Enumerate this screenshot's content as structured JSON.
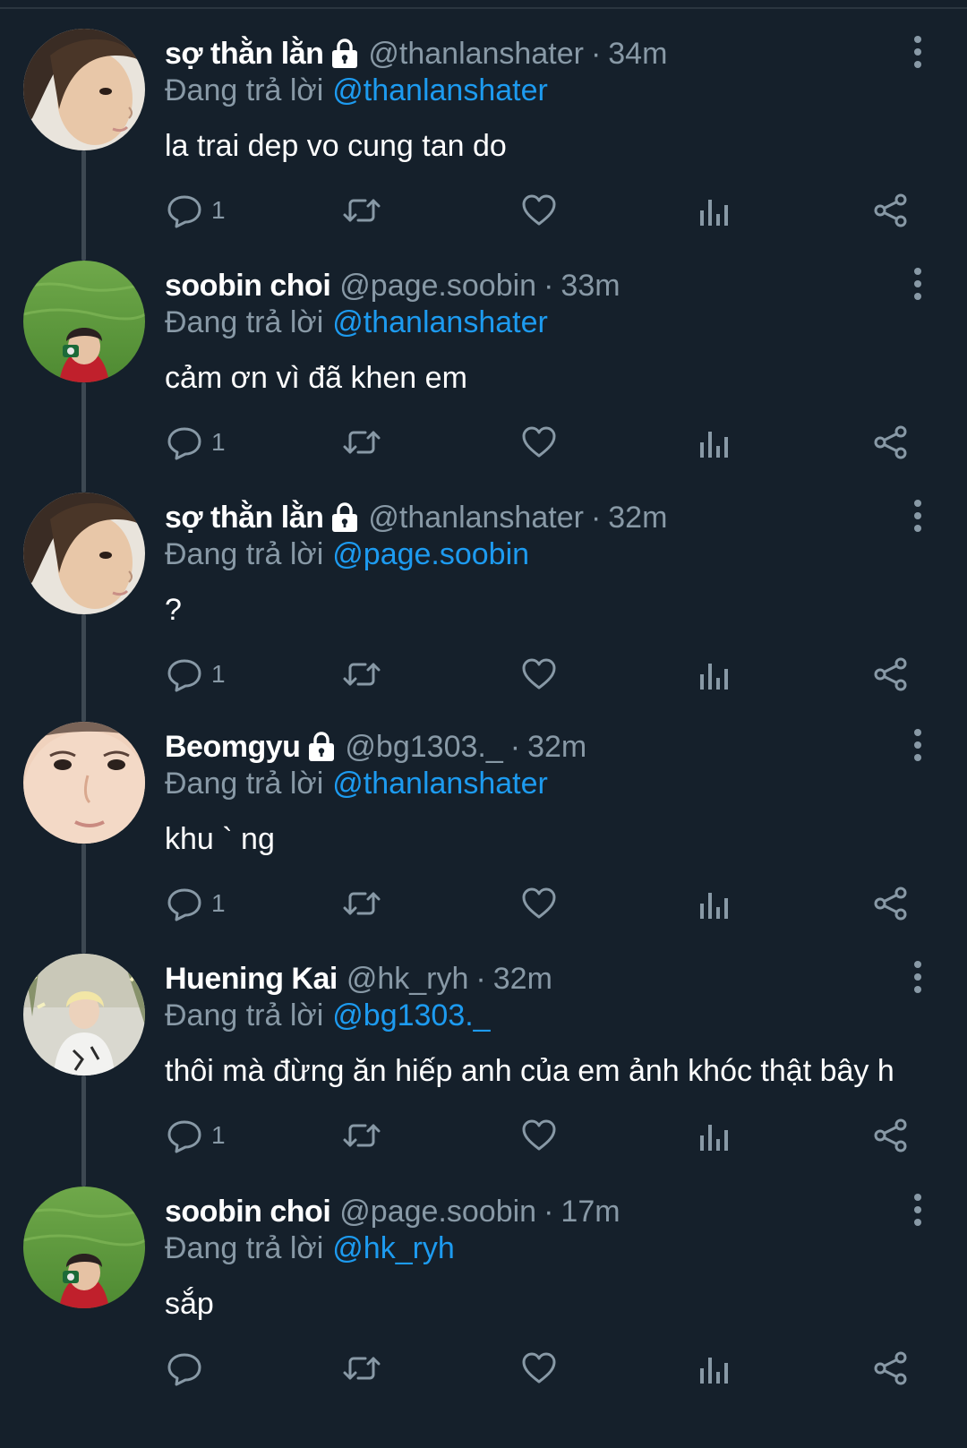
{
  "thread": {
    "tweets": [
      {
        "display_name": "sợ thằn lằn",
        "locked": true,
        "handle": "@thanlanshater",
        "separator": "·",
        "time": "34m",
        "reply_prefix": "Đang trả lời",
        "reply_to": "@thanlanshater",
        "text": "la trai dep vo cung tan do",
        "reply_count": "1",
        "avatar": "portrait-profile"
      },
      {
        "display_name": "soobin choi",
        "locked": false,
        "handle": "@page.soobin",
        "separator": "·",
        "time": "33m",
        "reply_prefix": "Đang trả lời",
        "reply_to": "@thanlanshater",
        "text": "cảm ơn vì đã khen em",
        "reply_count": "1",
        "avatar": "grass-photographer"
      },
      {
        "display_name": "sợ thằn lằn",
        "locked": true,
        "handle": "@thanlanshater",
        "separator": "·",
        "time": "32m",
        "reply_prefix": "Đang trả lời",
        "reply_to": "@page.soobin",
        "text": "?",
        "reply_count": "1",
        "avatar": "portrait-profile"
      },
      {
        "display_name": "Beomgyu",
        "locked": true,
        "handle": "@bg1303._",
        "separator": "·",
        "time": "32m",
        "reply_prefix": "Đang trả lời",
        "reply_to": "@thanlanshater",
        "text": "khu ` ng",
        "reply_count": "1",
        "avatar": "closeup-face"
      },
      {
        "display_name": "Huening Kai",
        "locked": false,
        "handle": "@hk_ryh",
        "separator": "·",
        "time": "32m",
        "reply_prefix": "Đang trả lời",
        "reply_to": "@bg1303._",
        "text": "thôi mà đừng ăn hiếp anh của em ảnh khóc thật bây h",
        "reply_count": "1",
        "avatar": "white-shirt-figure"
      },
      {
        "display_name": "soobin choi",
        "locked": false,
        "handle": "@page.soobin",
        "separator": "·",
        "time": "17m",
        "reply_prefix": "Đang trả lời",
        "reply_to": "@hk_ryh",
        "text": "sắp",
        "reply_count": "",
        "avatar": "grass-photographer"
      }
    ]
  },
  "icons": {
    "lock": "lock-icon",
    "more": "more-vertical-icon",
    "reply": "reply-bubble-icon",
    "retweet": "retweet-icon",
    "like": "heart-icon",
    "views": "analytics-bars-icon",
    "share": "share-icon"
  },
  "colors": {
    "background": "#15202b",
    "text_primary": "#ffffff",
    "text_secondary": "#8899a6",
    "link": "#1d9bf0",
    "thread_line": "#3d4852"
  }
}
